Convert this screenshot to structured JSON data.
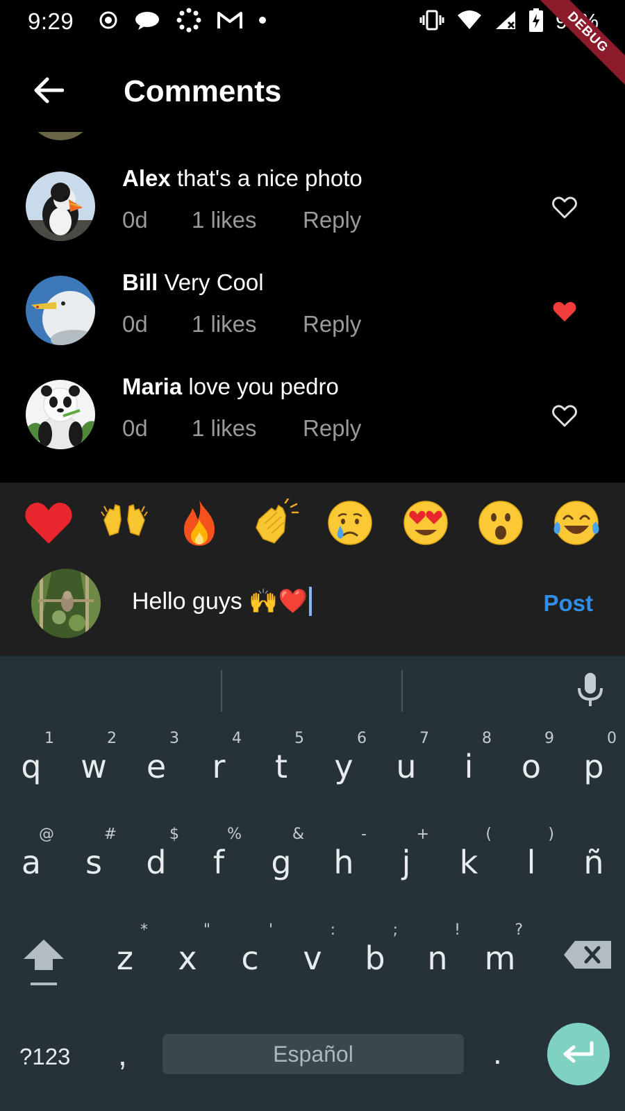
{
  "status_bar": {
    "time": "9:29",
    "battery": "91%",
    "debug_label": "DEBUG"
  },
  "app_bar": {
    "title": "Comments",
    "back_icon": "back-arrow-icon"
  },
  "comments": [
    {
      "user": "Alex",
      "text": "that's a nice photo",
      "time": "0d",
      "likes": "1 likes",
      "reply": "Reply",
      "liked": false
    },
    {
      "user": "Bill",
      "text": "Very Cool",
      "time": "0d",
      "likes": "1 likes",
      "reply": "Reply",
      "liked": true
    },
    {
      "user": "Maria",
      "text": "love you pedro",
      "time": "0d",
      "likes": "1 likes",
      "reply": "Reply",
      "liked": false
    }
  ],
  "reactions": [
    "❤️",
    "🙌",
    "🔥",
    "👏",
    "😢",
    "😍",
    "😮",
    "😂"
  ],
  "compose": {
    "value": "Hello guys 🙌❤️",
    "post_label": "Post"
  },
  "keyboard": {
    "row1": [
      {
        "ch": "q",
        "hint": "1"
      },
      {
        "ch": "w",
        "hint": "2"
      },
      {
        "ch": "e",
        "hint": "3"
      },
      {
        "ch": "r",
        "hint": "4"
      },
      {
        "ch": "t",
        "hint": "5"
      },
      {
        "ch": "y",
        "hint": "6"
      },
      {
        "ch": "u",
        "hint": "7"
      },
      {
        "ch": "i",
        "hint": "8"
      },
      {
        "ch": "o",
        "hint": "9"
      },
      {
        "ch": "p",
        "hint": "0"
      }
    ],
    "row2": [
      {
        "ch": "a",
        "hint": "@"
      },
      {
        "ch": "s",
        "hint": "#"
      },
      {
        "ch": "d",
        "hint": "$"
      },
      {
        "ch": "f",
        "hint": "%"
      },
      {
        "ch": "g",
        "hint": "&"
      },
      {
        "ch": "h",
        "hint": "-"
      },
      {
        "ch": "j",
        "hint": "+"
      },
      {
        "ch": "k",
        "hint": "("
      },
      {
        "ch": "l",
        "hint": ")"
      },
      {
        "ch": "ñ",
        "hint": ""
      }
    ],
    "row3": [
      {
        "ch": "z",
        "hint": "*"
      },
      {
        "ch": "x",
        "hint": "\""
      },
      {
        "ch": "c",
        "hint": "'"
      },
      {
        "ch": "v",
        "hint": ":"
      },
      {
        "ch": "b",
        "hint": ";"
      },
      {
        "ch": "n",
        "hint": "!"
      },
      {
        "ch": "m",
        "hint": "?"
      }
    ],
    "symbols_label": "?123",
    "comma": ",",
    "space_label": "Español",
    "period": "."
  },
  "colors": {
    "accent": "#2f8fe8",
    "liked_heart": "#f23c3c",
    "keyboard_bg": "#263238",
    "enter_key": "#7fd1c2"
  }
}
